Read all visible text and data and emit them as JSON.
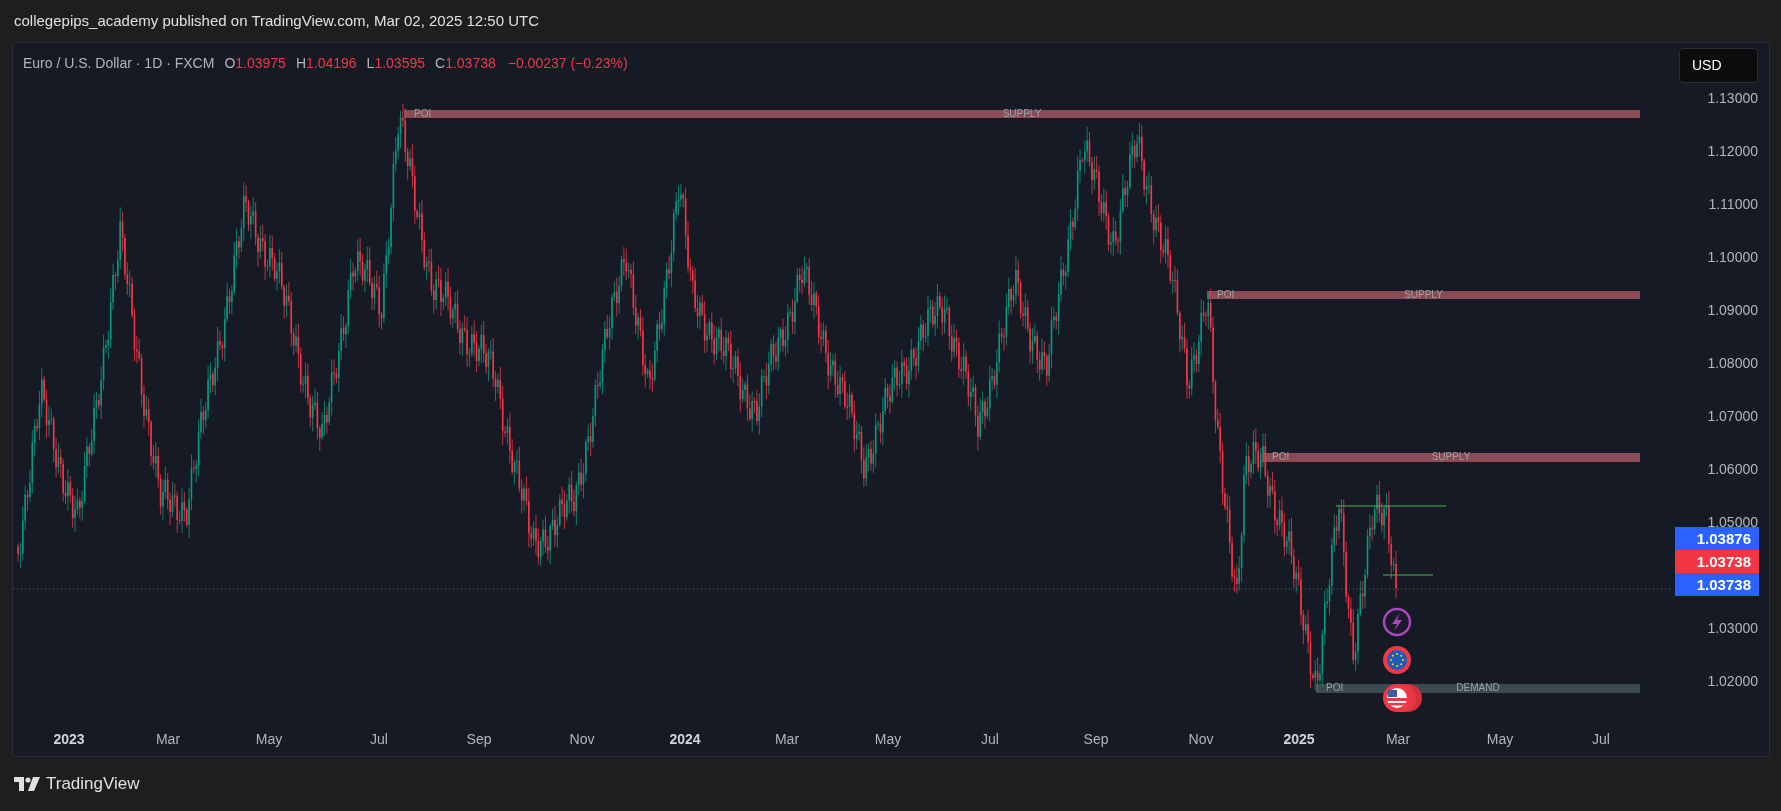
{
  "header": {
    "title": "collegepips_academy published on TradingView.com, Mar 02, 2025 12:50 UTC"
  },
  "legend": {
    "symbol": "Euro / U.S. Dollar · 1D · FXCM",
    "ohlc": [
      {
        "label": "O",
        "value": "1.03975"
      },
      {
        "label": "H",
        "value": "1.04196"
      },
      {
        "label": "L",
        "value": "1.03595"
      },
      {
        "label": "C",
        "value": "1.03738"
      }
    ],
    "change": "−0.00237 (−0.23%)"
  },
  "currency_button": {
    "label": "USD"
  },
  "zones": [
    {
      "kind": "supply",
      "poi": "POI",
      "label": "SUPPLY"
    },
    {
      "kind": "supply",
      "poi": "POI",
      "label": "SUPPLY"
    },
    {
      "kind": "supply",
      "poi": "POI",
      "label": "SUPPLY"
    },
    {
      "kind": "demand",
      "poi": "POI",
      "label": "DEMAND"
    }
  ],
  "price_axis": [
    "1.13000",
    "1.12000",
    "1.11000",
    "1.10000",
    "1.09000",
    "1.08000",
    "1.07000",
    "1.06000",
    "1.05000",
    "1.03000",
    "1.02000"
  ],
  "price_tags": [
    {
      "value": "1.03876",
      "color": "#2962ff"
    },
    {
      "value": "1.03738",
      "color": "#f23645"
    },
    {
      "value": "1.03738",
      "color": "#2962ff"
    }
  ],
  "time_axis": [
    {
      "label": "2023",
      "year": true
    },
    {
      "label": "Mar",
      "year": false
    },
    {
      "label": "May",
      "year": false
    },
    {
      "label": "Jul",
      "year": false
    },
    {
      "label": "Sep",
      "year": false
    },
    {
      "label": "Nov",
      "year": false
    },
    {
      "label": "2024",
      "year": true
    },
    {
      "label": "Mar",
      "year": false
    },
    {
      "label": "May",
      "year": false
    },
    {
      "label": "Jul",
      "year": false
    },
    {
      "label": "Sep",
      "year": false
    },
    {
      "label": "Nov",
      "year": false
    },
    {
      "label": "2025",
      "year": true
    },
    {
      "label": "Mar",
      "year": false
    },
    {
      "label": "May",
      "year": false
    },
    {
      "label": "Jul",
      "year": false
    }
  ],
  "footer": {
    "brand": "TradingView"
  }
}
